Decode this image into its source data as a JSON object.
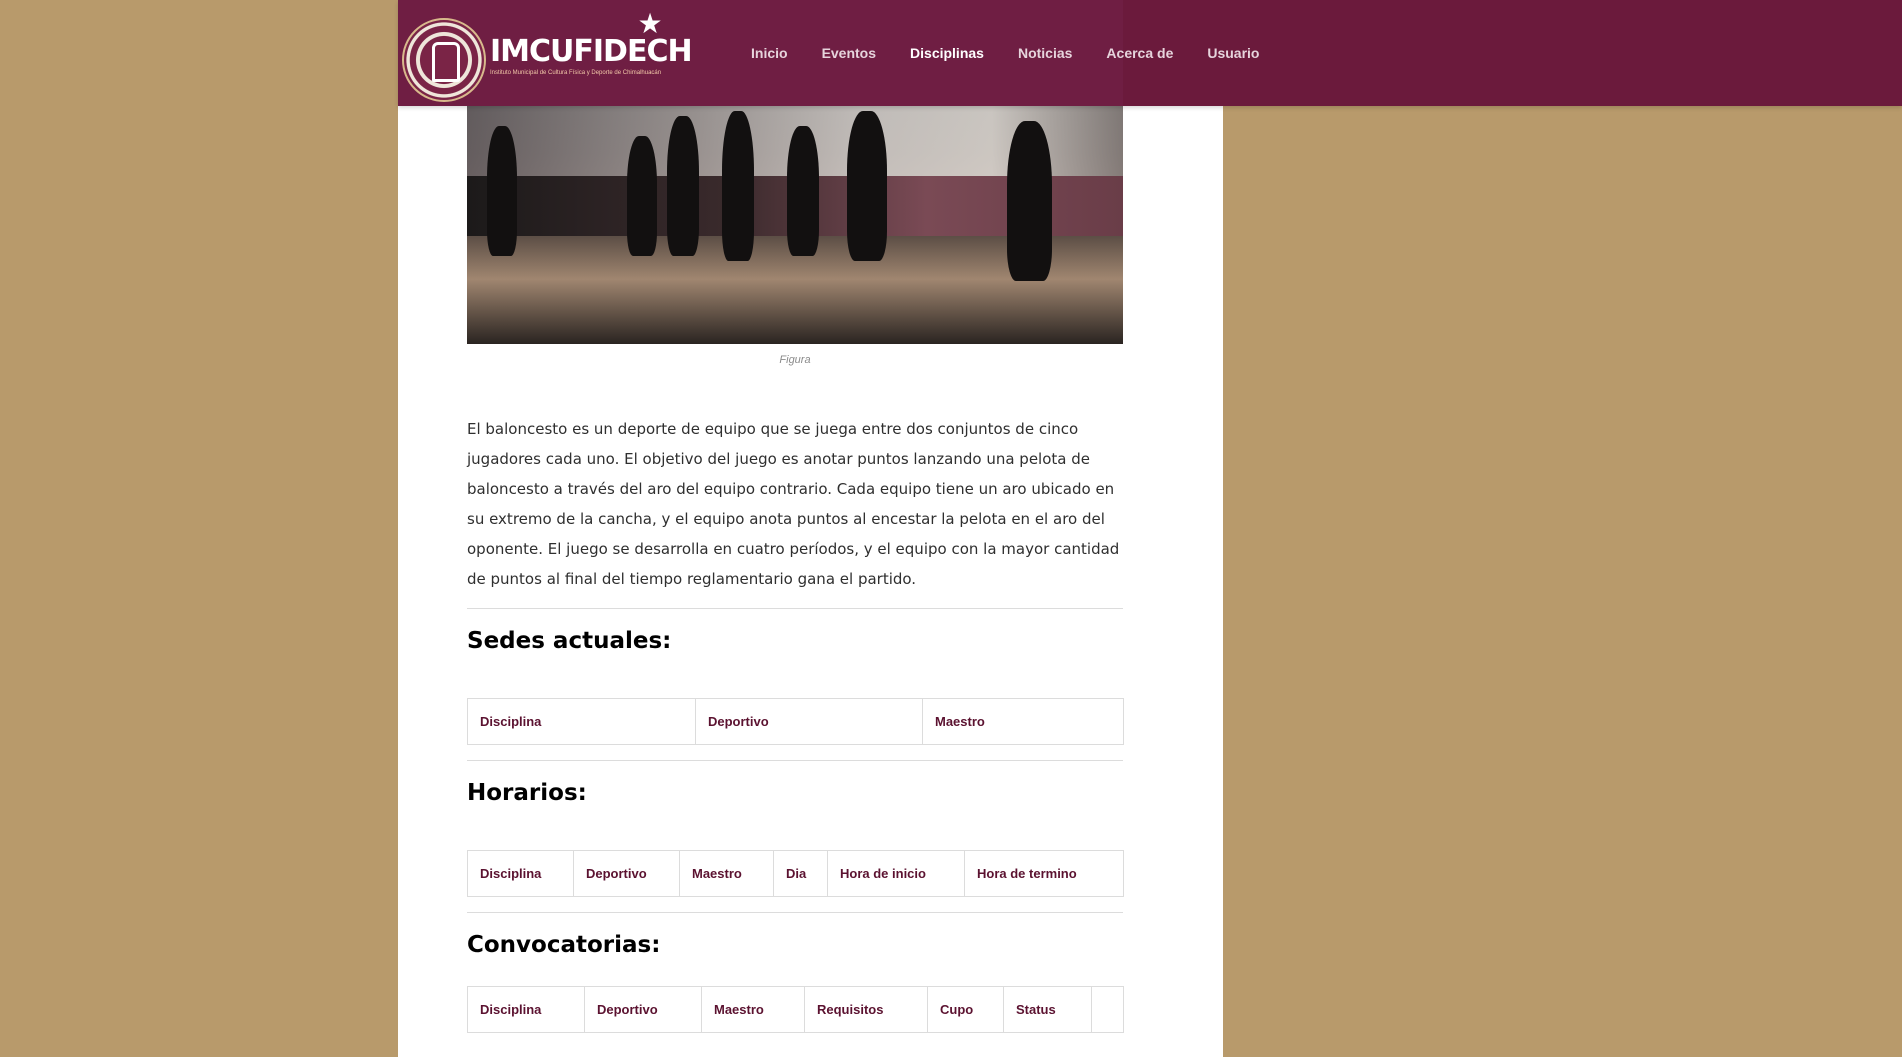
{
  "header": {
    "logo_text": "IMCUFIDECH",
    "logo_subtitle": "Instituto Municipal de Cultura Física y Deporte de Chimalhuacán",
    "nav": [
      {
        "label": "Inicio",
        "active": false
      },
      {
        "label": "Eventos",
        "active": false
      },
      {
        "label": "Disciplinas",
        "active": true
      },
      {
        "label": "Noticias",
        "active": false
      },
      {
        "label": "Acerca de",
        "active": false
      },
      {
        "label": "Usuario",
        "active": false
      }
    ]
  },
  "figure": {
    "caption": "Figura"
  },
  "description": "El baloncesto es un deporte de equipo que se juega entre dos conjuntos de cinco jugadores cada uno. El objetivo del juego es anotar puntos lanzando una pelota de baloncesto a través del aro del equipo contrario. Cada equipo tiene un aro ubicado en su extremo de la cancha, y el equipo anota puntos al encestar la pelota en el aro del oponente. El juego se desarrolla en cuatro períodos, y el equipo con la mayor cantidad de puntos al final del tiempo reglamentario gana el partido.",
  "sedes": {
    "title": "Sedes actuales:",
    "columns": [
      "Disciplina",
      "Deportivo",
      "Maestro"
    ]
  },
  "horarios": {
    "title": "Horarios:",
    "columns": [
      "Disciplina",
      "Deportivo",
      "Maestro",
      "Dia",
      "Hora de inicio",
      "Hora de termino"
    ]
  },
  "convocatorias": {
    "title": "Convocatorias:",
    "columns": [
      "Disciplina",
      "Deportivo",
      "Maestro",
      "Requisitos",
      "Cupo",
      "Status",
      ""
    ]
  },
  "colors": {
    "header_bg": "#6b1a3c",
    "page_bg": "#b89a6b",
    "table_header_text": "#5b1230"
  }
}
